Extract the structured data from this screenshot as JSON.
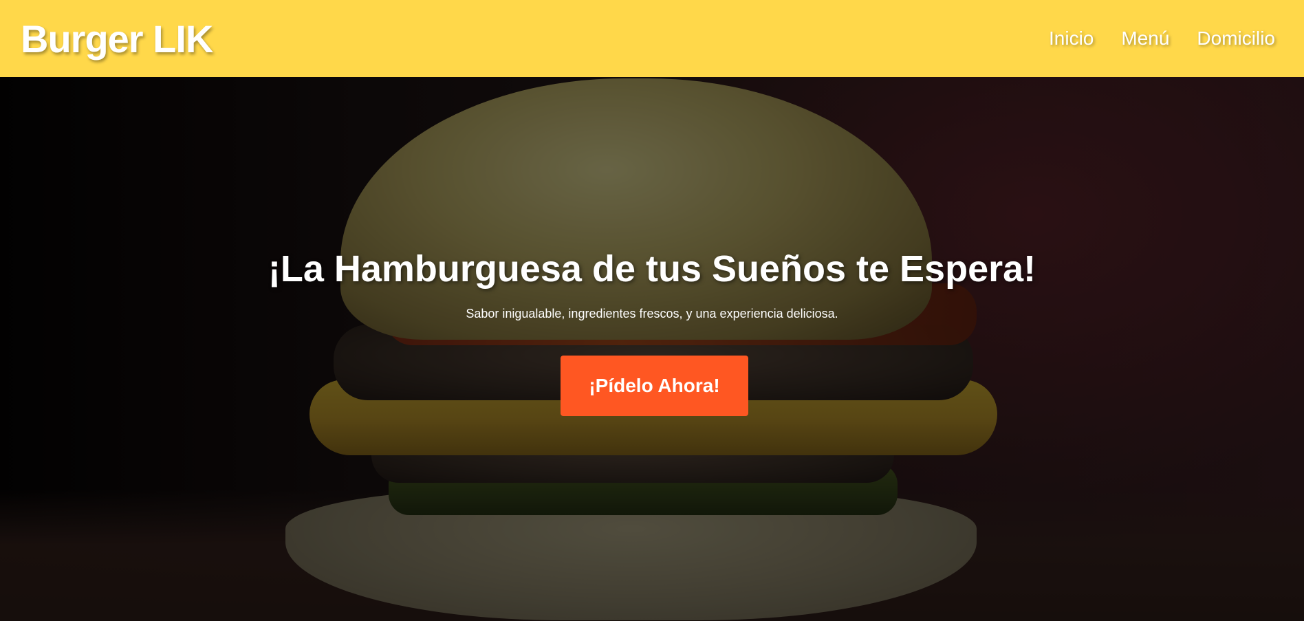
{
  "header": {
    "logo": "Burger LIK",
    "nav": [
      {
        "label": "Inicio"
      },
      {
        "label": "Menú"
      },
      {
        "label": "Domicilio"
      }
    ]
  },
  "hero": {
    "title": "¡La Hamburguesa de tus Sueños te Espera!",
    "subtitle": "Sabor inigualable, ingredientes frescos, y una experiencia deliciosa.",
    "cta_label": "¡Pídelo Ahora!"
  },
  "colors": {
    "header_bg": "#ffd84a",
    "cta_bg": "#ff5722",
    "text": "#ffffff"
  }
}
